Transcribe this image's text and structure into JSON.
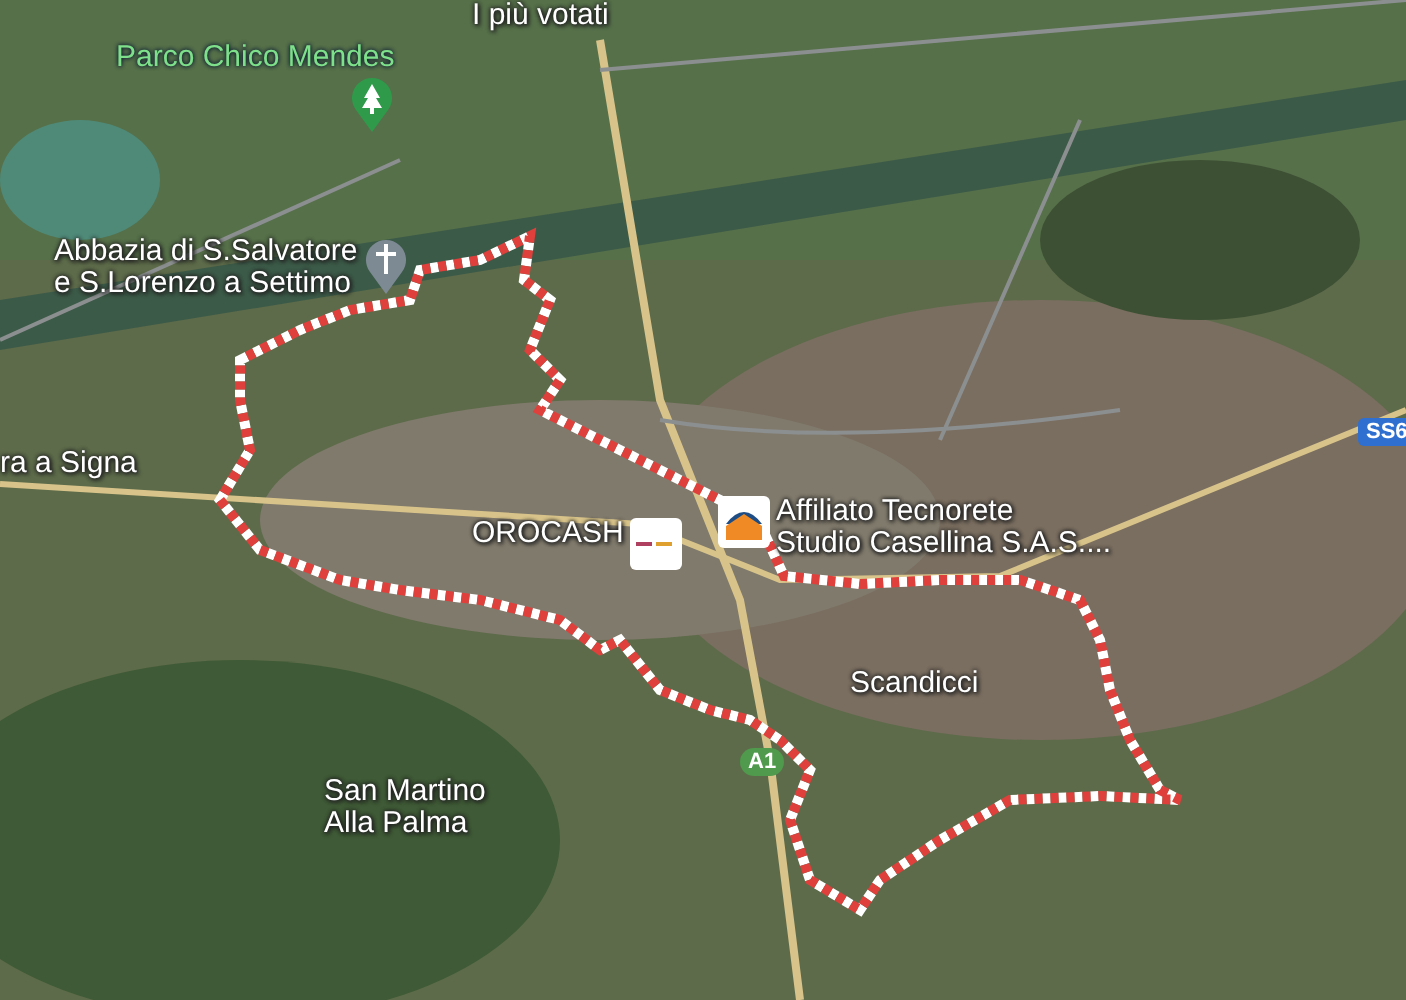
{
  "map": {
    "labels": [
      {
        "kind": "poi",
        "lines": [
          "I più votati"
        ]
      },
      {
        "kind": "park",
        "lines": [
          "Parco Chico Mendes"
        ]
      },
      {
        "kind": "church",
        "lines": [
          "Abbazia di S.Salvatore",
          "e S.Lorenzo a Settimo"
        ]
      },
      {
        "kind": "town",
        "lines": [
          "ra a Signa"
        ]
      },
      {
        "kind": "shop",
        "lines": [
          "OROCASH"
        ]
      },
      {
        "kind": "agency",
        "lines": [
          "Affiliato Tecnorete",
          "Studio Casellina S.A.S...."
        ]
      },
      {
        "kind": "town",
        "lines": [
          "Scandicci"
        ]
      },
      {
        "kind": "town",
        "lines": [
          "San Martino",
          "Alla Palma"
        ]
      }
    ],
    "shields": [
      {
        "kind": "motorway",
        "text": "A1"
      },
      {
        "kind": "state",
        "text": "SS6"
      }
    ]
  }
}
